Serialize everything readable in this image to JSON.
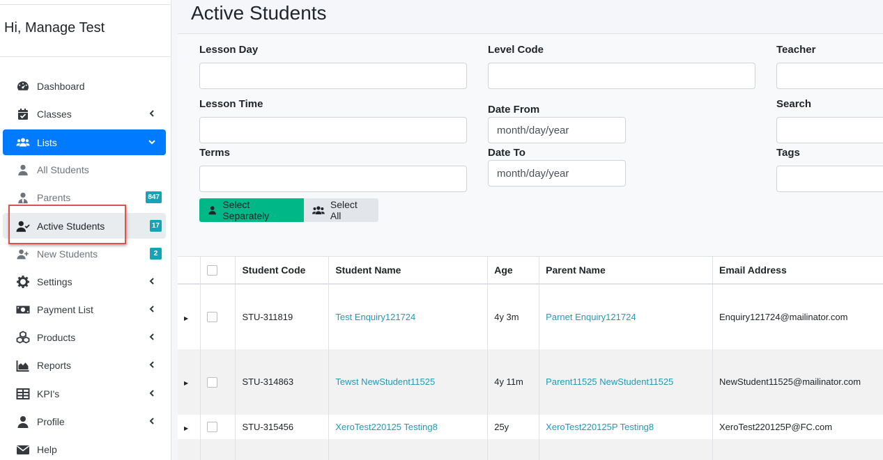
{
  "sidebar": {
    "greeting": "Hi, Manage Test",
    "items": [
      {
        "label": "Dashboard",
        "icon": "tachometer-icon"
      },
      {
        "label": "Classes",
        "icon": "calendar-check-icon"
      },
      {
        "label": "Lists",
        "icon": "users-icon"
      },
      {
        "label": "All Students",
        "icon": "user-icon"
      },
      {
        "label": "Parents",
        "icon": "user-tie-icon",
        "badge": "847"
      },
      {
        "label": "Active Students",
        "icon": "user-check-icon",
        "badge": "17"
      },
      {
        "label": "New Students",
        "icon": "user-plus-icon",
        "badge": "2"
      },
      {
        "label": "Settings",
        "icon": "gear-icon"
      },
      {
        "label": "Payment List",
        "icon": "money-bill-icon"
      },
      {
        "label": "Products",
        "icon": "cubes-icon"
      },
      {
        "label": "Reports",
        "icon": "area-chart-icon"
      },
      {
        "label": "KPI's",
        "icon": "table-icon"
      },
      {
        "label": "Profile",
        "icon": "user-icon"
      },
      {
        "label": "Help",
        "icon": "envelope-icon"
      }
    ]
  },
  "page": {
    "title": "Active Students"
  },
  "filters": {
    "lesson_day": {
      "label": "Lesson Day",
      "value": ""
    },
    "level_code": {
      "label": "Level Code",
      "value": ""
    },
    "teacher": {
      "label": "Teacher",
      "value": ""
    },
    "lesson_time": {
      "label": "Lesson Time",
      "value": ""
    },
    "date_from": {
      "label": "Date From",
      "placeholder": "month/day/year"
    },
    "search": {
      "label": "Search",
      "value": ""
    },
    "terms": {
      "label": "Terms",
      "value": ""
    },
    "date_to": {
      "label": "Date To",
      "placeholder": "month/day/year"
    },
    "tags": {
      "label": "Tags",
      "value": ""
    }
  },
  "buttons": {
    "select_separately": "Select Separately",
    "select_all": "Select All"
  },
  "table": {
    "headers": [
      "Student Code",
      "Student Name",
      "Age",
      "Parent Name",
      "Email Address"
    ],
    "rows": [
      {
        "code": "STU-311819",
        "name": "Test Enquiry121724",
        "age": "4y 3m",
        "parent": "Parnet Enquiry121724",
        "email": "Enquiry121724@mailinator.com"
      },
      {
        "code": "STU-314863",
        "name": "Tewst NewStudent11525",
        "age": "4y 11m",
        "parent": "Parent11525 NewStudent11525",
        "email": "NewStudent11525@mailinator.com"
      },
      {
        "code": "STU-315456",
        "name": "XeroTest220125 Testing8",
        "age": "25y",
        "parent": "XeroTest220125P Testing8",
        "email": "XeroTest220125P@FC.com"
      }
    ]
  },
  "colors": {
    "primary": "#007bff",
    "success": "#00b887",
    "link": "#1f9bb6",
    "badge": "#17a2b8",
    "highlight": "#d9534f"
  }
}
